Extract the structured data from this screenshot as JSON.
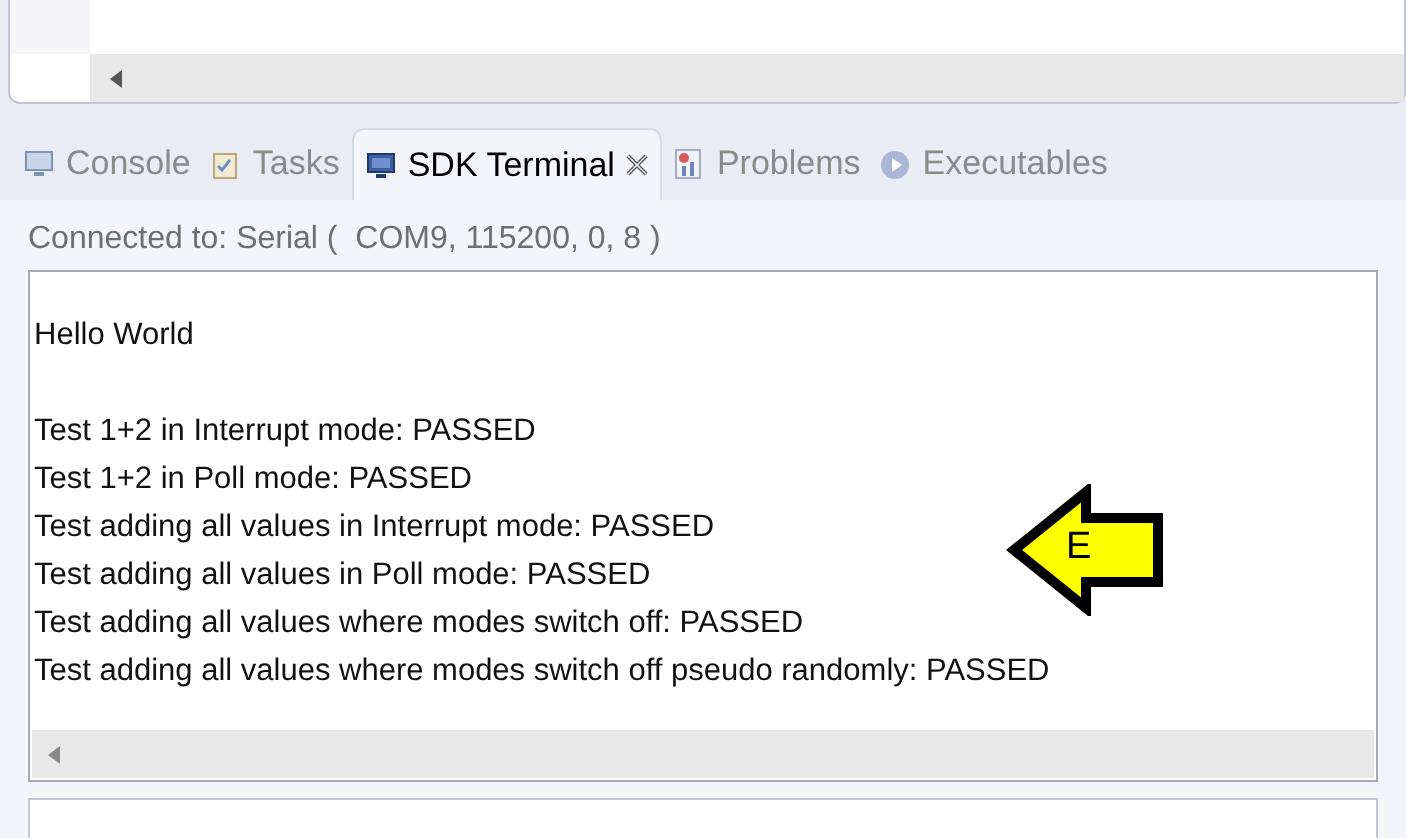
{
  "tabs": [
    {
      "label": "Console",
      "kind": "console",
      "selected": false
    },
    {
      "label": "Tasks",
      "kind": "tasks",
      "selected": false
    },
    {
      "label": "SDK Terminal",
      "kind": "terminal",
      "selected": true
    },
    {
      "label": "Problems",
      "kind": "problems",
      "selected": false
    },
    {
      "label": "Executables",
      "kind": "executables",
      "selected": false
    }
  ],
  "connection": "Connected to: Serial (  COM9, 115200, 0, 8 )",
  "terminal_blocks": [
    [
      "Hello World"
    ],
    [
      "Test 1+2 in Interrupt mode: PASSED",
      "Test 1+2 in Poll mode: PASSED",
      "Test adding all values in Interrupt mode: PASSED",
      "Test adding all values in Poll mode: PASSED",
      "Test adding all values where modes switch off: PASSED",
      "Test adding all values where modes switch off pseudo randomly: PASSED"
    ]
  ],
  "callout": {
    "label": "E"
  }
}
